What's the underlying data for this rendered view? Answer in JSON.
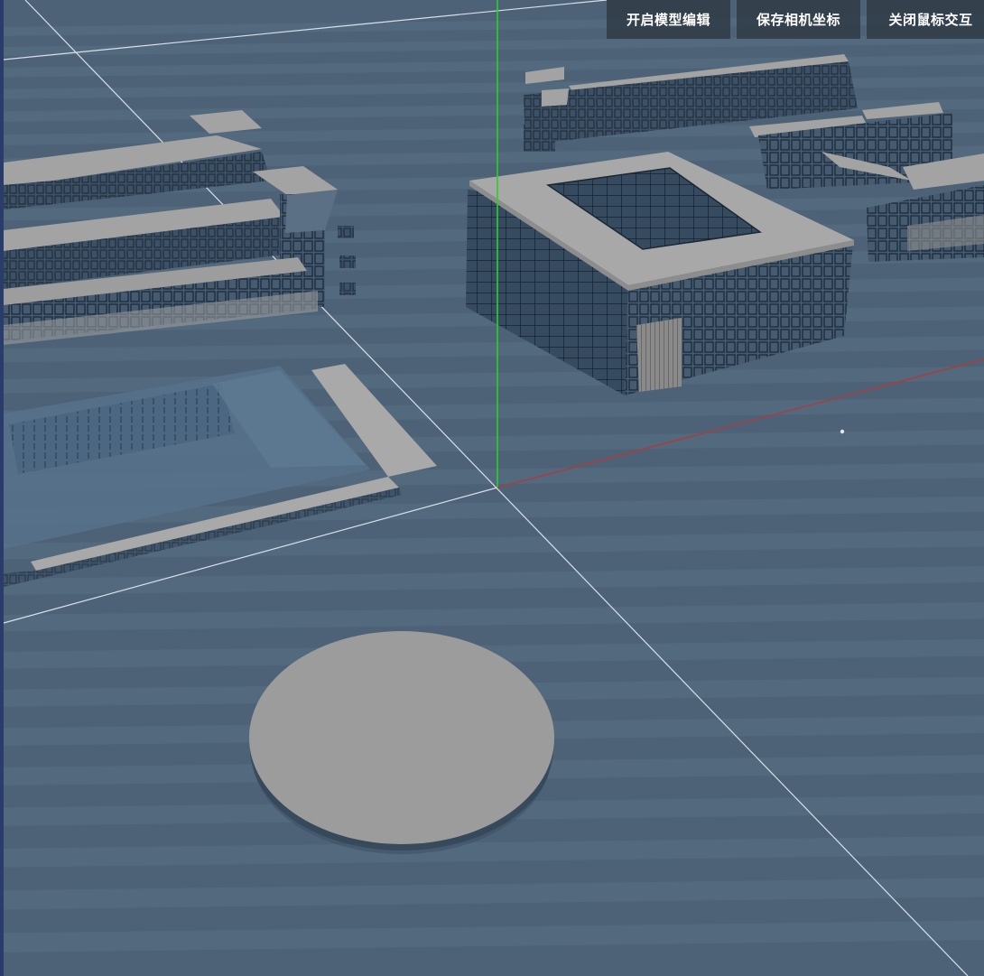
{
  "toolbar": {
    "buttons": [
      {
        "label": "开启模型编辑"
      },
      {
        "label": "保存相机坐标"
      },
      {
        "label": "关闭鼠标交互"
      }
    ]
  },
  "scene": {
    "ground_color": "#4d6276",
    "stripe_color": "#5a6f83",
    "building_roof_color": "#a8a8a8",
    "wall_color": "#2e3f50",
    "glass_color": "#3f566c",
    "axis_y_color": "#2ad12a",
    "axis_x_color": "#b0393c",
    "grid_line_color": "#e6eef5",
    "disk_color": "#9c9c9c"
  }
}
